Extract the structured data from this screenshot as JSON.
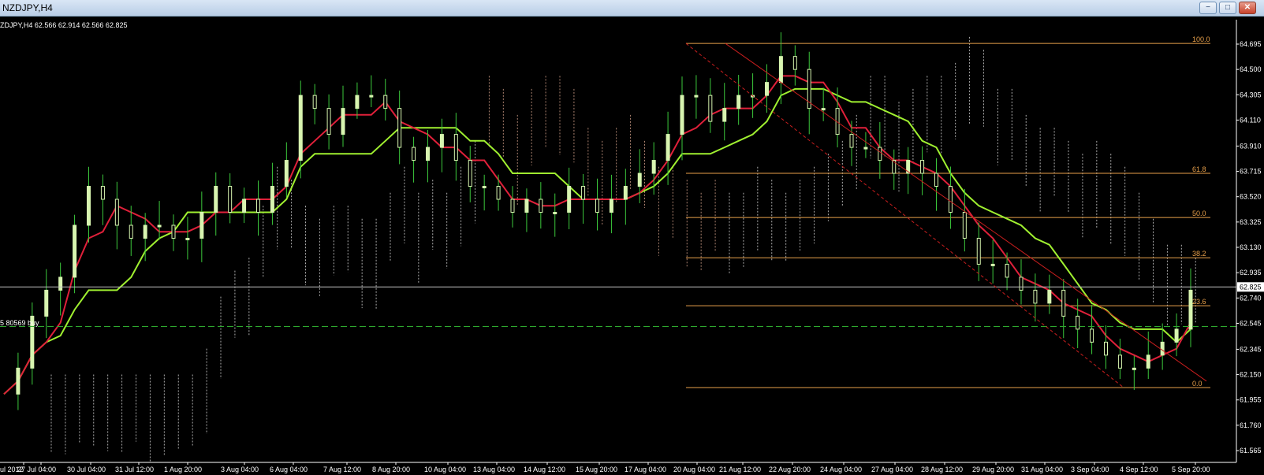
{
  "window": {
    "title": "NZDJPY,H4",
    "minimize_glyph": "−",
    "maximize_glyph": "□",
    "close_glyph": "✕"
  },
  "chart_header": {
    "text": "ZDJPY,H4  62.566 62.914 62.566 62.825"
  },
  "trade_label": "5  80569 buy",
  "current_price": "62.825",
  "colors": {
    "bull": "#d8f5b0",
    "wick": "#3cc93c",
    "tenkan": "#e0203a",
    "kijun": "#a0f030",
    "cloud": "#d9d9d9",
    "cloud_bear": "#d8a48c",
    "fib": "#e8a04a",
    "trend": "#c81e1e",
    "order": "#2ea82e"
  },
  "chart_data": {
    "type": "candlestick",
    "symbol": "NZDJPY",
    "timeframe": "H4",
    "ohlc_header": {
      "open": 62.566,
      "high": 62.914,
      "low": 62.566,
      "close": 62.825
    },
    "y_ticks": [
      "64.695",
      "64.500",
      "64.305",
      "64.110",
      "63.910",
      "63.715",
      "63.520",
      "63.325",
      "63.130",
      "62.935",
      "62.740",
      "62.545",
      "62.345",
      "62.150",
      "61.955",
      "61.760",
      "61.565"
    ],
    "x_ticks": [
      "ul 2012",
      "27 Jul 04:00",
      "30 Jul 04:00",
      "31 Jul 12:00",
      "1 Aug 20:00",
      "3 Aug 04:00",
      "6 Aug 04:00",
      "7 Aug 12:00",
      "8 Aug 20:00",
      "10 Aug 04:00",
      "13 Aug 04:00",
      "14 Aug 12:00",
      "15 Aug 20:00",
      "17 Aug 04:00",
      "20 Aug 04:00",
      "21 Aug 12:00",
      "22 Aug 20:00",
      "24 Aug 04:00",
      "27 Aug 04:00",
      "28 Aug 12:00",
      "29 Aug 20:00",
      "31 Aug 04:00",
      "3 Sep 04:00",
      "4 Sep 12:00",
      "5 Sep 20:00"
    ],
    "fibonacci": [
      {
        "level": "100.0",
        "price": 64.7
      },
      {
        "level": "61.8",
        "price": 63.7
      },
      {
        "level": "50.0",
        "price": 63.36
      },
      {
        "level": "38.2",
        "price": 63.05
      },
      {
        "level": "23.6",
        "price": 62.68
      },
      {
        "level": "0.0",
        "price": 62.05
      }
    ],
    "price_line": 62.825,
    "order_line": 62.52,
    "close_path": [
      62.0,
      62.2,
      62.6,
      62.8,
      62.9,
      63.3,
      63.6,
      63.5,
      63.3,
      63.2,
      63.3,
      63.3,
      63.2,
      63.2,
      63.4,
      63.6,
      63.4,
      63.5,
      63.4,
      63.6,
      63.8,
      64.3,
      64.2,
      64.0,
      64.2,
      64.3,
      64.3,
      64.2,
      63.9,
      63.8,
      63.9,
      64.0,
      63.8,
      63.6,
      63.6,
      63.5,
      63.4,
      63.5,
      63.4,
      63.4,
      63.6,
      63.5,
      63.4,
      63.5,
      63.6,
      63.7,
      63.8,
      64.0,
      64.3,
      64.3,
      64.1,
      64.2,
      64.3,
      64.3,
      64.4,
      64.6,
      64.5,
      64.2,
      64.2,
      64.0,
      63.9,
      63.9,
      63.8,
      63.7,
      63.8,
      63.7,
      63.6,
      63.4,
      63.2,
      63.0,
      63.0,
      62.9,
      62.8,
      62.7,
      62.8,
      62.6,
      62.5,
      62.4,
      62.3,
      62.2,
      62.2,
      62.3,
      62.4,
      62.5,
      62.8
    ]
  }
}
